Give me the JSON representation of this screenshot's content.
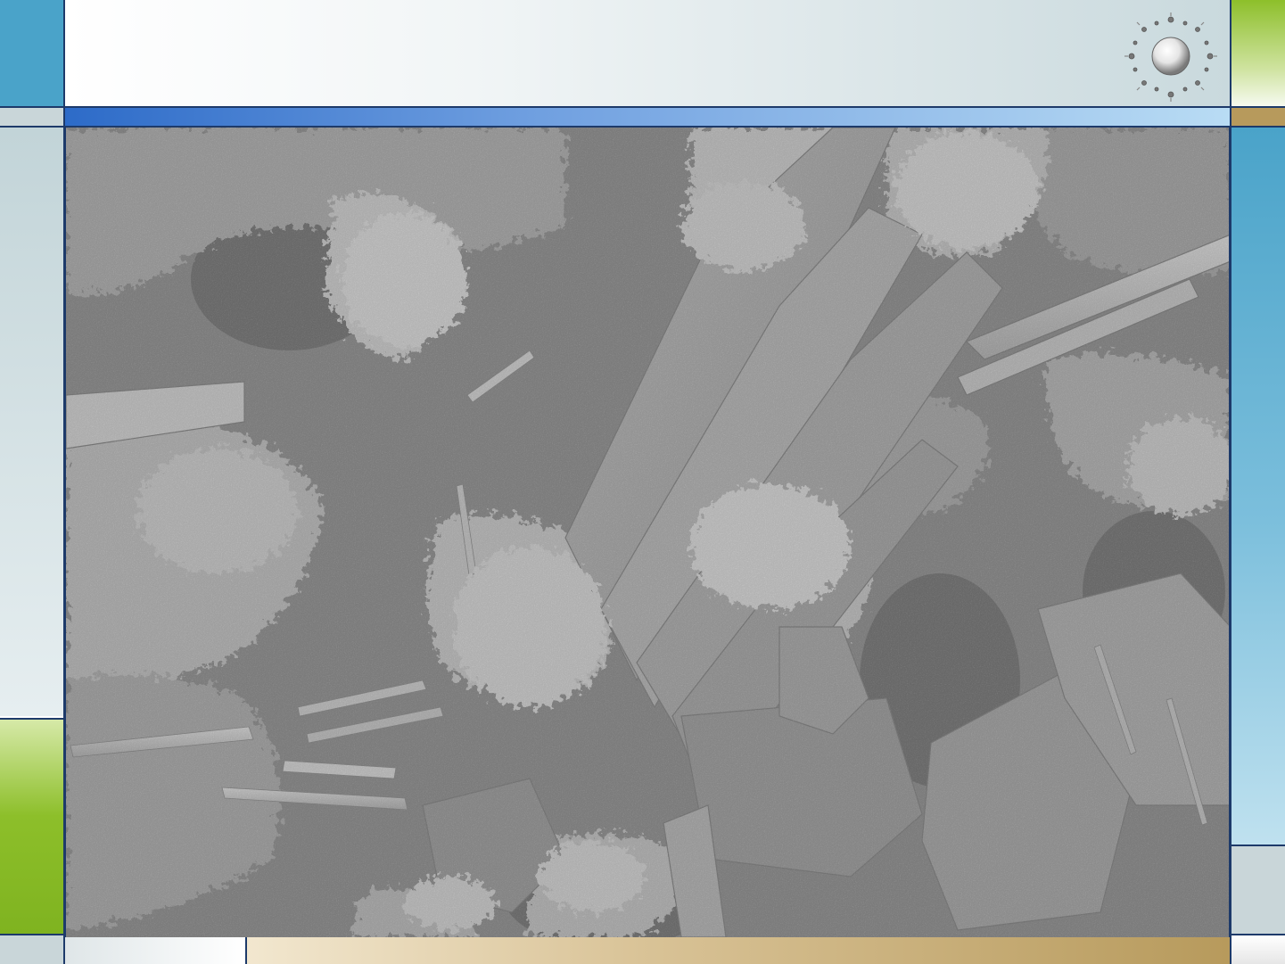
{
  "slide": {
    "colors": {
      "blue_panel": "#4aa3c9",
      "green_accent": "#8dbf2a",
      "gold_accent": "#b79a5c",
      "header_gradient_start": "#ffffff",
      "header_gradient_end": "#c7d8dc",
      "rule_blue_start": "#2d6bc8",
      "rule_blue_end": "#b9dcf4",
      "border_navy": "#1d3a6a"
    },
    "icons": [
      "sun-burst-logo-icon"
    ],
    "image": {
      "kind": "scanning-electron-micrograph",
      "subject": "crystal-formations"
    }
  }
}
